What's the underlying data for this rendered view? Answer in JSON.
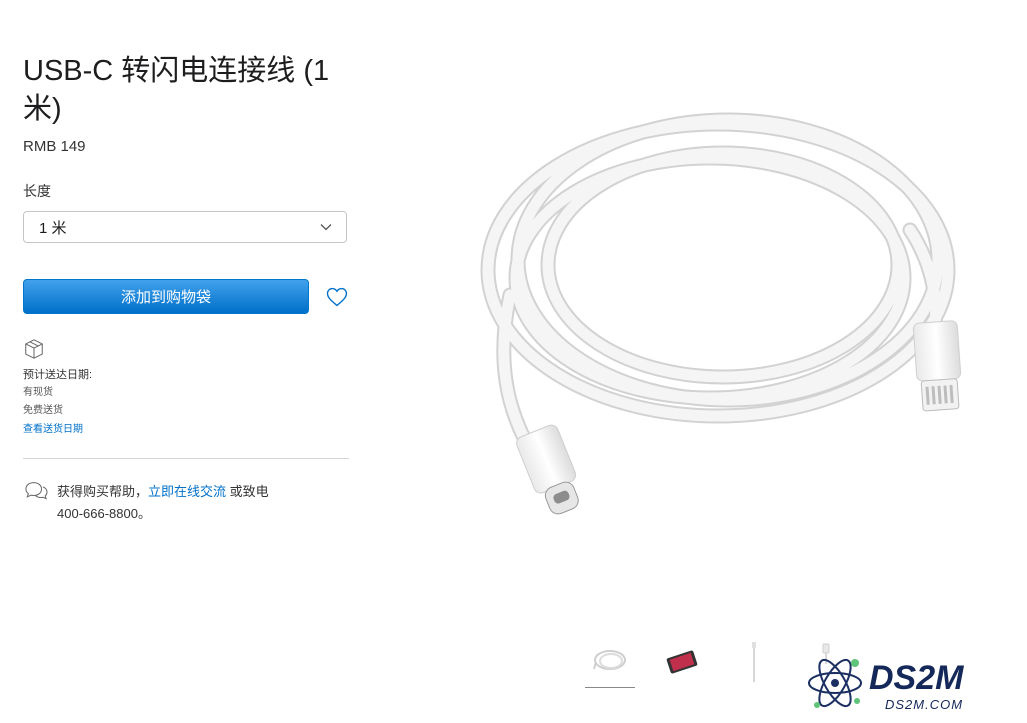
{
  "product": {
    "title": "USB-C 转闪电连接线 (1 米)",
    "price": "RMB 149"
  },
  "options": {
    "length_label": "长度",
    "length_selected": "1 米"
  },
  "actions": {
    "add_to_bag": "添加到购物袋",
    "favorite_icon": "heart-icon"
  },
  "shipping": {
    "heading": "预计送达日期:",
    "line1": "有现货",
    "line2": "免费送货",
    "link": "查看送货日期"
  },
  "help": {
    "prefix": "获得购买帮助，",
    "chat_link": "立即在线交流",
    "suffix": "或致电",
    "phone": "400-666-8800。"
  },
  "gallery": {
    "thumbnails": [
      "cable-coil",
      "ipad-device",
      "cable-straight",
      "connector-tip"
    ]
  },
  "watermark": {
    "brand": "DS2M",
    "domain": "DS2M.COM"
  },
  "colors": {
    "accent": "#0070c9",
    "button_top": "#42a1ec",
    "text": "#1d1d1f"
  }
}
